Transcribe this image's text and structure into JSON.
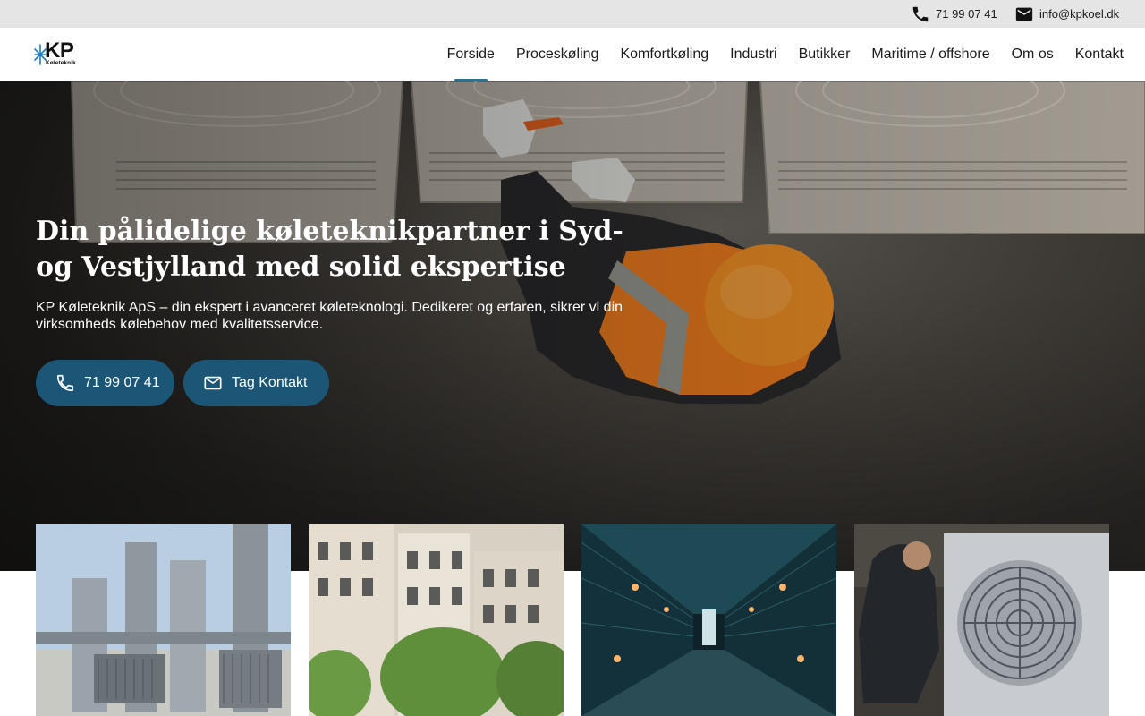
{
  "topbar": {
    "phone": "71 99 07 41",
    "email": "info@kpkoel.dk",
    "phone_icon": "phone-icon",
    "email_icon": "mail-icon"
  },
  "logo": {
    "mark": "KP",
    "subtitle": "Køleteknik",
    "icon": "snowflake-icon"
  },
  "nav": {
    "items": [
      {
        "label": "Forside",
        "active": true
      },
      {
        "label": "Proceskøling"
      },
      {
        "label": "Komfortkøling"
      },
      {
        "label": "Industri"
      },
      {
        "label": "Butikker"
      },
      {
        "label": "Maritime / offshore"
      },
      {
        "label": "Om os"
      },
      {
        "label": "Kontakt"
      }
    ]
  },
  "hero": {
    "title": "Din pålidelige køleteknikpartner i Syd- og Vestjylland med solid ekspertise",
    "text": "KP Køleteknik ApS – din ekspert i avanceret køleteknologi. Dedikeret og erfaren, sikrer vi din virksomheds kølebehov med kvalitetsservice.",
    "btn_phone": "71 99 07 41",
    "btn_contact": "Tag Kontakt"
  },
  "colors": {
    "accent": "#1c5677",
    "topbar_bg": "#e5e5e5",
    "active_underline": "#2f6f8f"
  }
}
